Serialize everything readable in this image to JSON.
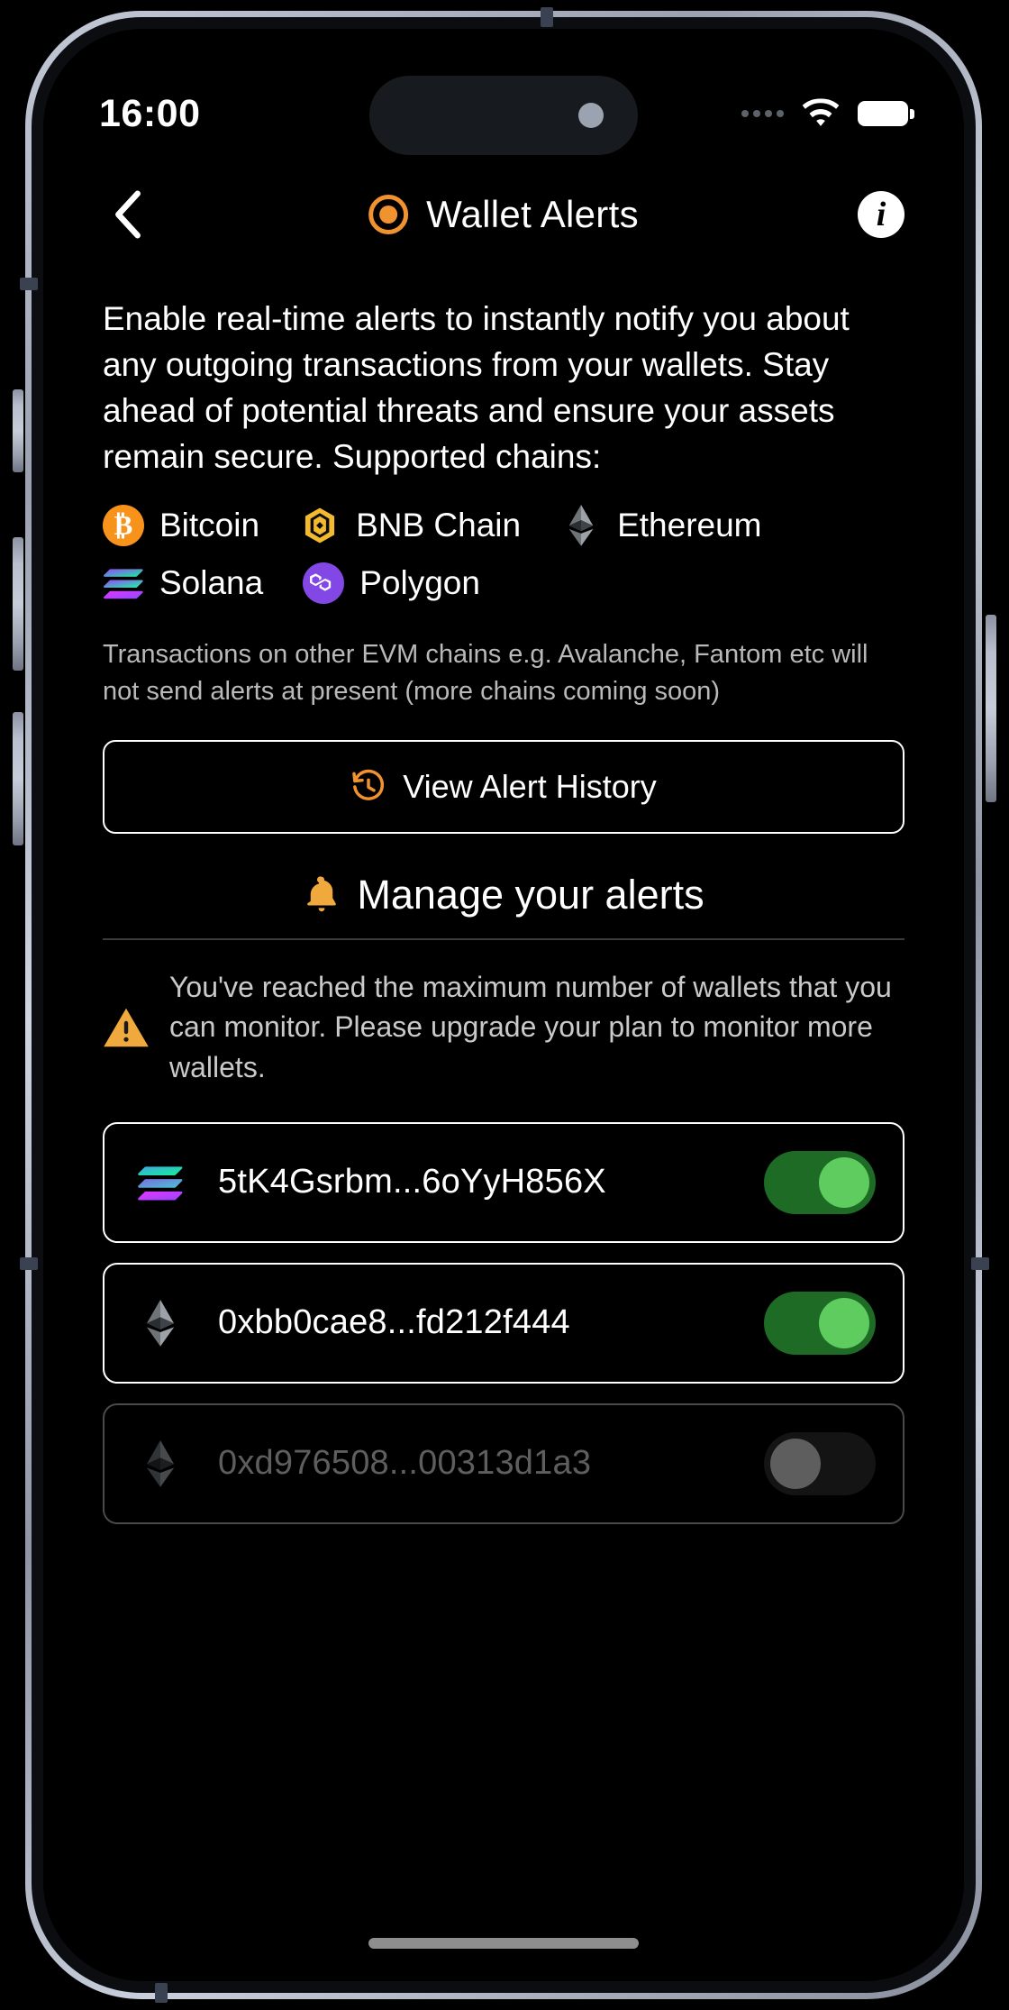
{
  "status_bar": {
    "time": "16:00",
    "signal_icon": "cellular-dots-icon",
    "wifi_icon": "wifi-icon",
    "battery_icon": "battery-full-icon"
  },
  "header": {
    "back_icon": "chevron-left-icon",
    "brand_icon": "target-dot-icon",
    "title": "Wallet Alerts",
    "info_icon": "info-circle-icon"
  },
  "intro": {
    "text": "Enable real-time alerts to instantly notify you about any outgoing transactions from your wallets. Stay ahead of potential threats and ensure your assets remain secure. Supported chains:"
  },
  "chains": [
    {
      "name": "Bitcoin",
      "icon": "bitcoin-icon",
      "color": "#f7931a"
    },
    {
      "name": "BNB Chain",
      "icon": "bnb-icon",
      "color": "#f3ba2f"
    },
    {
      "name": "Ethereum",
      "icon": "ethereum-icon",
      "color": "#8a8f95"
    },
    {
      "name": "Solana",
      "icon": "solana-icon",
      "color": "#14f195"
    },
    {
      "name": "Polygon",
      "icon": "polygon-icon",
      "color": "#8247e5"
    }
  ],
  "disclaimer": {
    "text": "Transactions on other EVM chains e.g. Avalanche, Fantom etc will not send alerts at present (more chains coming soon)"
  },
  "alert_history_button": {
    "label": "View Alert History",
    "icon": "clock-rewind-icon",
    "icon_color": "#f0922f"
  },
  "manage_section": {
    "title": "Manage your alerts",
    "icon": "bell-icon",
    "icon_color": "#f0a93c"
  },
  "warning": {
    "icon": "warning-triangle-icon",
    "icon_color": "#f0a93c",
    "text": "You've reached the maximum number of wallets that you can monitor. Please upgrade your plan to monitor more wallets."
  },
  "wallets": [
    {
      "address": "5tK4Gsrbm...6oYyH856X",
      "chain_icon": "solana-icon",
      "enabled": true,
      "toggle_state": "on"
    },
    {
      "address": "0xbb0cae8...fd212f444",
      "chain_icon": "ethereum-icon",
      "enabled": true,
      "toggle_state": "on"
    },
    {
      "address": "0xd976508...00313d1a3",
      "chain_icon": "ethereum-icon",
      "enabled": false,
      "toggle_state": "off"
    }
  ],
  "colors": {
    "accent_orange": "#f0922f",
    "toggle_on_track": "#1d6b25",
    "toggle_on_knob": "#5fcc60",
    "toggle_off_track": "#141414",
    "toggle_off_knob": "#5e5e5e",
    "background": "#000000"
  }
}
